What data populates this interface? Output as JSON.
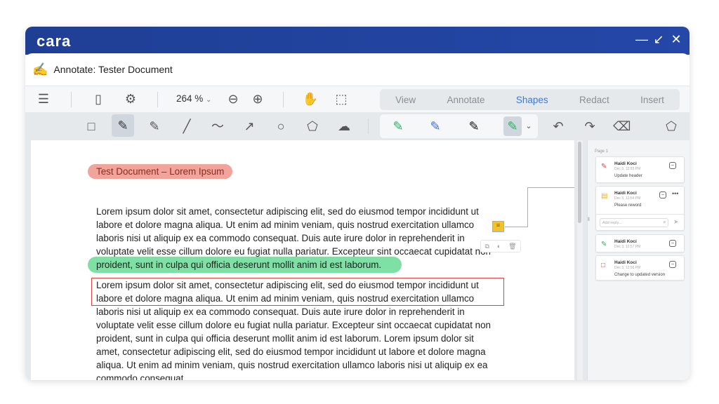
{
  "app": {
    "logo": "cara",
    "title": "Annotate: Tester Document"
  },
  "toolbar": {
    "zoom": "264 %",
    "tabs": [
      "View",
      "Annotate",
      "Shapes",
      "Redact",
      "Insert"
    ],
    "active_tab": "Shapes"
  },
  "document": {
    "heading": "Test Document – Lorem Ipsum",
    "para1": [
      "Lorem ipsum dolor sit amet, consectetur adipiscing elit, sed do eiusmod tempor incididunt ut",
      "labore et dolore magna aliqua. Ut enim ad minim veniam, quis nostrud exercitation ullamco",
      "laboris nisi ut aliquip ex ea commodo consequat. Duis aute irure dolor in reprehenderit in",
      "voluptate velit esse cillum dolore eu fugiat nulla pariatur. Excepteur sint occaecat cupidatat non",
      "proident, sunt in culpa qui officia deserunt mollit anim id est laborum."
    ],
    "para2": [
      "Lorem ipsum dolor sit amet, consectetur adipiscing elit, sed do eiusmod tempor incididunt ut",
      "labore et dolore magna aliqua. Ut enim ad minim veniam, quis nostrud exercitation ullamco",
      "laboris nisi ut aliquip ex ea commodo consequat. Duis aute irure dolor in reprehenderit in",
      "voluptate velit esse cillum dolore eu fugiat nulla pariatur. Excepteur sint occaecat cupidatat non",
      "proident, sunt in culpa qui officia deserunt mollit anim id est laborum. Lorem ipsum dolor sit",
      "amet, consectetur adipiscing elit, sed do eiusmod tempor incididunt ut labore et dolore magna",
      "aliqua. Ut enim ad minim veniam, quis nostrud exercitation ullamco laboris nisi ut aliquip ex ea",
      "commodo consequat."
    ]
  },
  "comments": {
    "page_label": "Page 1",
    "reply_placeholder": "Add reply...",
    "items": [
      {
        "author": "Haidi Koci",
        "date": "Dec 3, 12:55 PM",
        "text": "Update header",
        "icon": "pen-red"
      },
      {
        "author": "Haidi Koci",
        "date": "Dec 3, 12:54 PM",
        "text": "Please reword",
        "icon": "note-yellow"
      },
      {
        "author": "Haidi Koci",
        "date": "Dec 3, 12:57 PM",
        "text": "",
        "icon": "pen-green"
      },
      {
        "author": "Haidi Koci",
        "date": "Dec 3, 12:56 PM",
        "text": "Change to updated version",
        "icon": "rect-red"
      }
    ]
  },
  "colors": {
    "titlebar": "#2447a8",
    "accent": "#3a7bd5",
    "highlight": "#7fe0a6",
    "header_highlight": "#f0a49c",
    "rect": "#d9453b"
  }
}
